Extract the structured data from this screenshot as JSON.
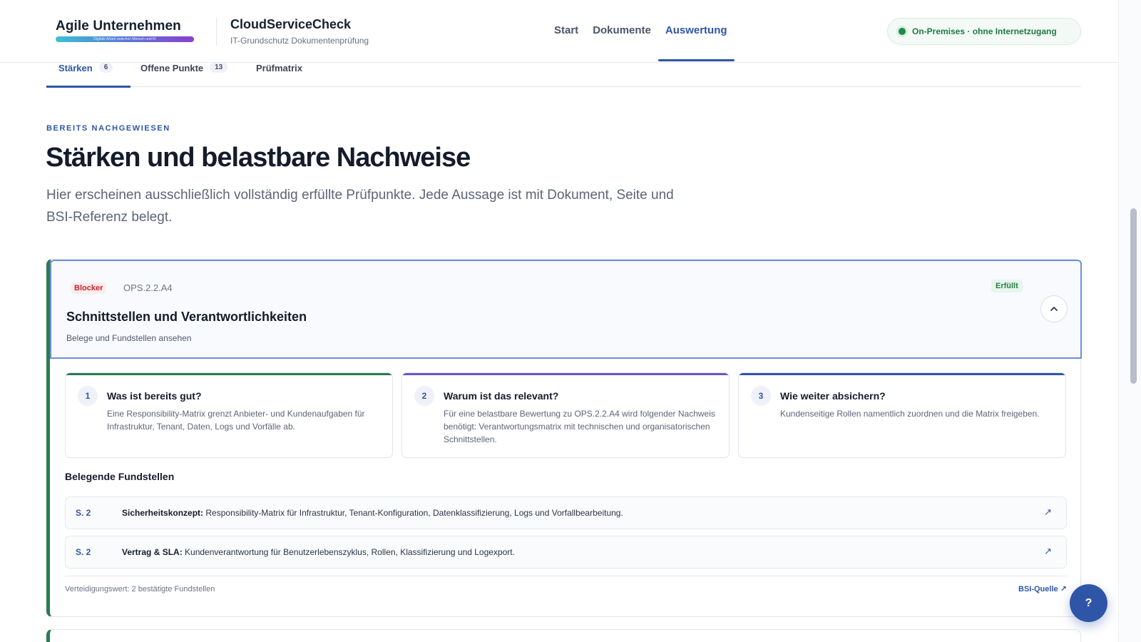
{
  "header": {
    "logo": {
      "name": "Agile Unternehmen",
      "tagline": "Digitale Arbeit zwischen Mensch und KI"
    },
    "app_title": "CloudServiceCheck",
    "app_subtitle": "IT-Grundschutz Dokumentenprüfung",
    "nav": [
      {
        "label": "Start",
        "active": false
      },
      {
        "label": "Dokumente",
        "active": false
      },
      {
        "label": "Auswertung",
        "active": true
      }
    ],
    "status": {
      "label": "On-Premises · ohne Internetzugang",
      "color": "#1e8a4a"
    }
  },
  "tabs": [
    {
      "label": "Stärken",
      "count": "6",
      "active": true
    },
    {
      "label": "Offene Punkte",
      "count": "13",
      "active": false
    },
    {
      "label": "Prüfmatrix",
      "count": "",
      "active": false
    }
  ],
  "intro": {
    "eyebrow": "BEREITS NACHGEWIESEN",
    "title": "Stärken und belastbare Nachweise",
    "description": "Hier erscheinen ausschließlich vollständig erfüllte Prüfpunkte. Jede Aussage ist mit Dokument, Seite und BSI-Referenz belegt."
  },
  "card": {
    "severity": "Blocker",
    "control_id": "OPS.2.2.A4",
    "status": "Erfüllt",
    "title": "Schnittstellen und Verantwortlichkeiten",
    "subtitle": "Belege und Fundstellen ansehen",
    "collapse_icon": "chevron-up-icon",
    "steps": [
      {
        "number": "1",
        "title": "Was ist bereits gut?",
        "text": "Eine Responsibility-Matrix grenzt Anbieter- und Kundenaufgaben für Infrastruktur, Tenant, Daten, Logs und Vorfälle ab.",
        "accent": "#2b7a53"
      },
      {
        "number": "2",
        "title": "Warum ist das relevant?",
        "text": "Für eine belastbare Bewertung zu OPS.2.2.A4 wird folgender Nachweis benötigt: Verantwortungsmatrix mit technischen und organisatorischen Schnittstellen.",
        "accent": "#6c55c9"
      },
      {
        "number": "3",
        "title": "Wie weiter absichern?",
        "text": "Kundenseitige Rollen namentlich zuordnen und die Matrix freigeben.",
        "accent": "#2f55a8"
      }
    ],
    "evidence_title": "Belegende Fundstellen",
    "evidence": [
      {
        "page": "S. 2",
        "document": "Sicherheitskonzept:",
        "text": "Responsibility-Matrix für Infrastruktur, Tenant-Konfiguration, Datenklassifizierung, Logs und Vorfallbearbeitung.",
        "link_icon": "external-link-icon"
      },
      {
        "page": "S. 2",
        "document": "Vertrag & SLA:",
        "text": "Kundenverantwortung für Benutzerlebenszyklus, Rollen, Klassifizierung und Logexport.",
        "link_icon": "external-link-icon"
      }
    ],
    "footer_note": "Verteidigungswert: 2 bestätigte Fundstellen",
    "bsi_link": "BSI-Quelle ↗"
  },
  "help_button": "?"
}
